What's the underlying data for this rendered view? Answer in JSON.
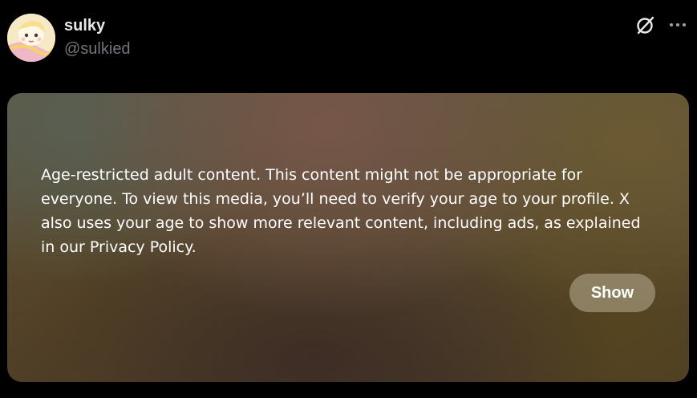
{
  "author": {
    "display_name": "sulky",
    "handle": "@sulkied",
    "avatar_icon": "avatar-image"
  },
  "header_actions": {
    "grok_icon": "grok-icon",
    "more_icon": "more-options-icon"
  },
  "media": {
    "warning_text": "Age-restricted adult content. This content might not be appropriate for everyone. To view this media, you’ll need to verify your age to your profile. X also uses your age to show more relevant content, including ads, as explained in our Privacy Policy.",
    "show_label": "Show"
  },
  "colors": {
    "background": "#000000",
    "primary_text": "#e7e9ea",
    "secondary_text": "#71767b",
    "button_bg": "rgba(185,175,150,0.55)"
  }
}
